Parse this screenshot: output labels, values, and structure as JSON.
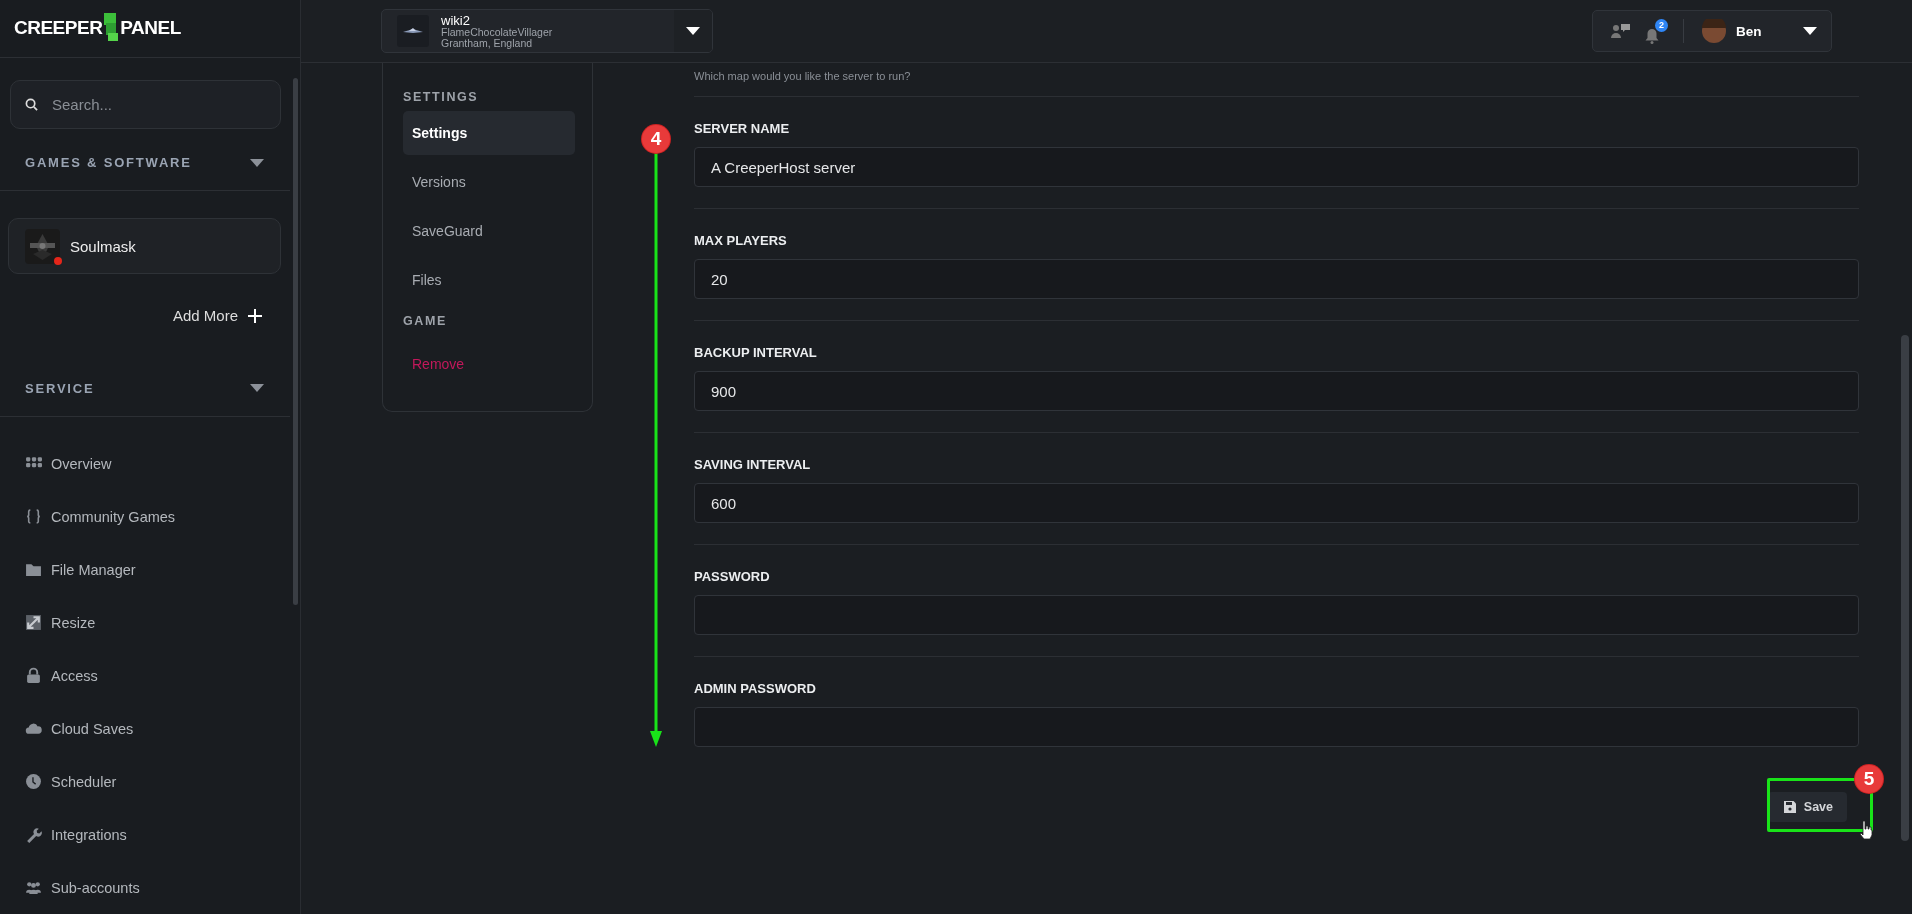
{
  "logo": {
    "part_1": "CREEPER",
    "part_2": "PANEL"
  },
  "sidebar": {
    "search": {
      "placeholder": "Search..."
    },
    "games_heading": "GAMES & SOFTWARE",
    "games": [
      {
        "name": "Soulmask",
        "color": "#e5261a"
      }
    ],
    "add_more": "Add More",
    "service_heading": "SERVICE",
    "nav": [
      {
        "label": "Overview",
        "kind": "grid"
      },
      {
        "label": "Community Games",
        "kind": "braces"
      },
      {
        "label": "File Manager",
        "kind": "folder"
      },
      {
        "label": "Resize",
        "kind": "resize"
      },
      {
        "label": "Access",
        "kind": "lock"
      },
      {
        "label": "Cloud Saves",
        "kind": "cloud"
      },
      {
        "label": "Scheduler",
        "kind": "clock"
      },
      {
        "label": "Integrations",
        "kind": "wrench"
      },
      {
        "label": "Sub-accounts",
        "kind": "people"
      }
    ]
  },
  "server_selector": {
    "name": "wiki2",
    "owner": "FlameChocolateVillager",
    "location": "Grantham, England"
  },
  "user_menu": {
    "notification_count": "2",
    "username": "Ben"
  },
  "settings_menu": {
    "groups": [
      {
        "heading": "SETTINGS",
        "items": [
          {
            "label": "Settings",
            "selected": true,
            "kind": "normal"
          },
          {
            "label": "Versions",
            "selected": false,
            "kind": "normal"
          },
          {
            "label": "SaveGuard",
            "selected": false,
            "kind": "normal"
          },
          {
            "label": "Files",
            "selected": false,
            "kind": "normal"
          }
        ]
      },
      {
        "heading": "GAME",
        "items": [
          {
            "label": "Remove",
            "selected": false,
            "kind": "danger"
          }
        ]
      }
    ]
  },
  "form": {
    "hint": "Which map would you like the server to run?",
    "fields": [
      {
        "label": "SERVER NAME",
        "value": "A CreeperHost server"
      },
      {
        "label": "MAX PLAYERS",
        "value": "20"
      },
      {
        "label": "BACKUP INTERVAL",
        "value": "900"
      },
      {
        "label": "SAVING INTERVAL",
        "value": "600"
      },
      {
        "label": "PASSWORD"
      },
      {
        "label": "ADMIN PASSWORD"
      }
    ],
    "save_button": "Save"
  },
  "annotations": [
    {
      "label": "4",
      "kind": "arrow"
    },
    {
      "label": "5",
      "kind": "box"
    }
  ]
}
